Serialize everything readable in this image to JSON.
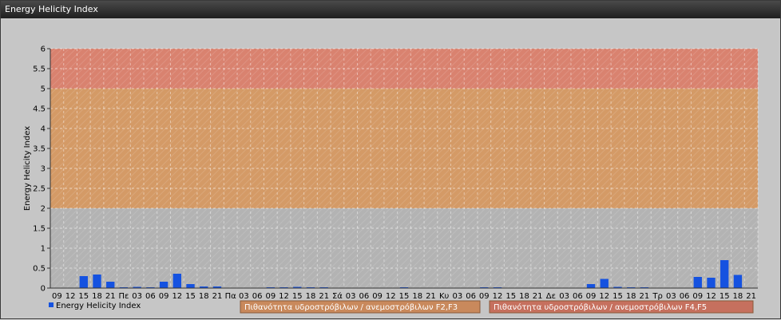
{
  "window": {
    "title": "Energy Helicity Index"
  },
  "chart_data": {
    "type": "bar",
    "ylabel": "Energy Helicity Index",
    "ylim": [
      0,
      6
    ],
    "yticks": [
      "0",
      "0.5",
      "1",
      "1.5",
      "2",
      "2.5",
      "3",
      "3.5",
      "4",
      "4.5",
      "5",
      "5.5",
      "6"
    ],
    "grid": true,
    "bands": [
      {
        "from": 0,
        "to": 2,
        "color": "#b3b3b3"
      },
      {
        "from": 2,
        "to": 5,
        "color": "#d49a66",
        "label": "Πιθανότητα υδροστρόβιλων / ανεμοστρόβιλων F2,F3"
      },
      {
        "from": 5,
        "to": 6,
        "color": "#d9826f",
        "label": "Πιθανότητα υδροστρόβιλων / ανεμοστρόβιλων F4,F5"
      }
    ],
    "categories": [
      "09",
      "12",
      "15",
      "18",
      "21",
      "Πε",
      "03",
      "06",
      "09",
      "12",
      "15",
      "18",
      "21",
      "Πα",
      "03",
      "06",
      "09",
      "12",
      "15",
      "18",
      "21",
      "Σά",
      "03",
      "06",
      "09",
      "12",
      "15",
      "18",
      "21",
      "Κυ",
      "03",
      "06",
      "09",
      "12",
      "15",
      "18",
      "21",
      "Δε",
      "03",
      "06",
      "09",
      "12",
      "15",
      "18",
      "21",
      "Τρ",
      "03",
      "06",
      "09",
      "12",
      "15",
      "18",
      "21"
    ],
    "series": [
      {
        "name": "Energy Helicity Index",
        "color": "#1552e0",
        "values": [
          0.01,
          0.01,
          0.3,
          0.34,
          0.16,
          0.02,
          0.03,
          0.02,
          0.16,
          0.36,
          0.1,
          0.04,
          0.04,
          0.01,
          0.01,
          0.01,
          0.02,
          0.02,
          0.03,
          0.02,
          0.02,
          0.01,
          0.01,
          0.01,
          0.01,
          0.01,
          0.02,
          0.01,
          0.01,
          0.01,
          0.01,
          0.01,
          0.02,
          0.02,
          0.01,
          0.01,
          0.01,
          0.01,
          0.01,
          0.01,
          0.1,
          0.23,
          0.03,
          0.02,
          0.02,
          0.01,
          0.01,
          0.01,
          0.28,
          0.26,
          0.7,
          0.33,
          0.01
        ]
      }
    ],
    "legend": {
      "placement": "bottom-left",
      "label": "Energy Helicity Index"
    }
  }
}
